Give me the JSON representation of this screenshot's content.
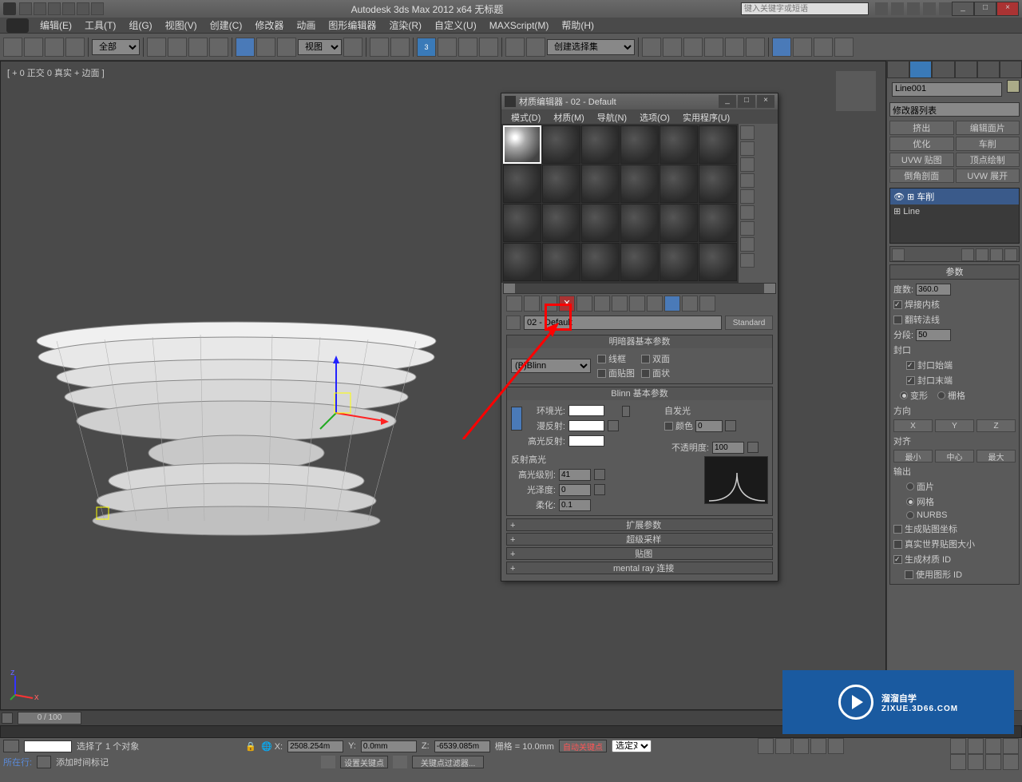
{
  "app": {
    "title": "Autodesk 3ds Max 2012 x64   无标题",
    "search_placeholder": "键入关键字或短语"
  },
  "menubar": [
    "编辑(E)",
    "工具(T)",
    "组(G)",
    "视图(V)",
    "创建(C)",
    "修改器",
    "动画",
    "图形编辑器",
    "渲染(R)",
    "自定义(U)",
    "MAXScript(M)",
    "帮助(H)"
  ],
  "toolbar": {
    "filter_all": "全部",
    "ref_system": "视图",
    "selection_set": "创建选择集"
  },
  "viewport": {
    "label": "[ + 0 正交 0 真实 + 边面 ]"
  },
  "modifier_panel": {
    "object_name": "Line001",
    "list_label": "修改器列表",
    "buttons": [
      "挤出",
      "编辑面片",
      "优化",
      "车削",
      "UVW 贴图",
      "顶点绘制",
      "倒角剖面",
      "UVW 展开"
    ],
    "stack": [
      {
        "name": "车削",
        "selected": true,
        "expand": true,
        "eye": true
      },
      {
        "name": "Line",
        "selected": false,
        "expand": true,
        "eye": false
      }
    ]
  },
  "params": {
    "title": "参数",
    "degrees_label": "度数:",
    "degrees": "360.0",
    "weld_core": "焊接内核",
    "flip_normals": "翻转法线",
    "segments_label": "分段:",
    "segments": "50",
    "capping_group": "封口",
    "cap_start": "封口始端",
    "cap_end": "封口末端",
    "morph": "变形",
    "grid": "栅格",
    "direction_group": "方向",
    "dir_x": "X",
    "dir_y": "Y",
    "dir_z": "Z",
    "align_group": "对齐",
    "align_min": "最小",
    "align_center": "中心",
    "align_max": "最大",
    "output_group": "输出",
    "out_patch": "面片",
    "out_mesh": "网格",
    "out_nurbs": "NURBS",
    "gen_map": "生成贴图坐标",
    "real_world": "真实世界贴图大小",
    "gen_mat_id": "生成材质 ID",
    "use_shape_id": "使用图形 ID"
  },
  "mat_editor": {
    "title": "材质编辑器 - 02 - Default",
    "menus": [
      "模式(D)",
      "材质(M)",
      "导航(N)",
      "选项(O)",
      "实用程序(U)"
    ],
    "mat_name": "02 - Default",
    "type_btn": "Standard",
    "shader_rollout": "明暗器基本参数",
    "shader": "(B)Blinn",
    "wire": "线框",
    "two_sided": "双面",
    "face_map": "面贴图",
    "faceted": "面状",
    "blinn_rollout": "Blinn 基本参数",
    "ambient": "环境光:",
    "diffuse": "漫反射:",
    "specular": "高光反射:",
    "self_illum": "自发光",
    "color_label": "颜色",
    "self_illum_val": "0",
    "opacity": "不透明度:",
    "opacity_val": "100",
    "spec_highlights": "反射高光",
    "spec_level": "高光级别:",
    "spec_level_val": "41",
    "glossiness": "光泽度:",
    "glossiness_val": "0",
    "soften": "柔化:",
    "soften_val": "0.1",
    "rollouts_collapsed": [
      "扩展参数",
      "超级采样",
      "贴图",
      "mental ray 连接"
    ]
  },
  "status": {
    "selected_text": "选择了 1 个对象",
    "x_val": "2508.254m",
    "y_val": "0.0mm",
    "z_val": "-6539.085m",
    "grid_val": "栅格 = 10.0mm",
    "add_time_tag": "添加时间标记",
    "auto_key": "自动关键点",
    "set_key": "设置关键点",
    "selected_filter": "选定对",
    "key_filter": "关键点过滤器...",
    "prompt": "所在行:",
    "frame": "0 / 100"
  },
  "watermark": {
    "main": "溜溜自学",
    "sub": "ZIXUE.3D66.COM"
  }
}
